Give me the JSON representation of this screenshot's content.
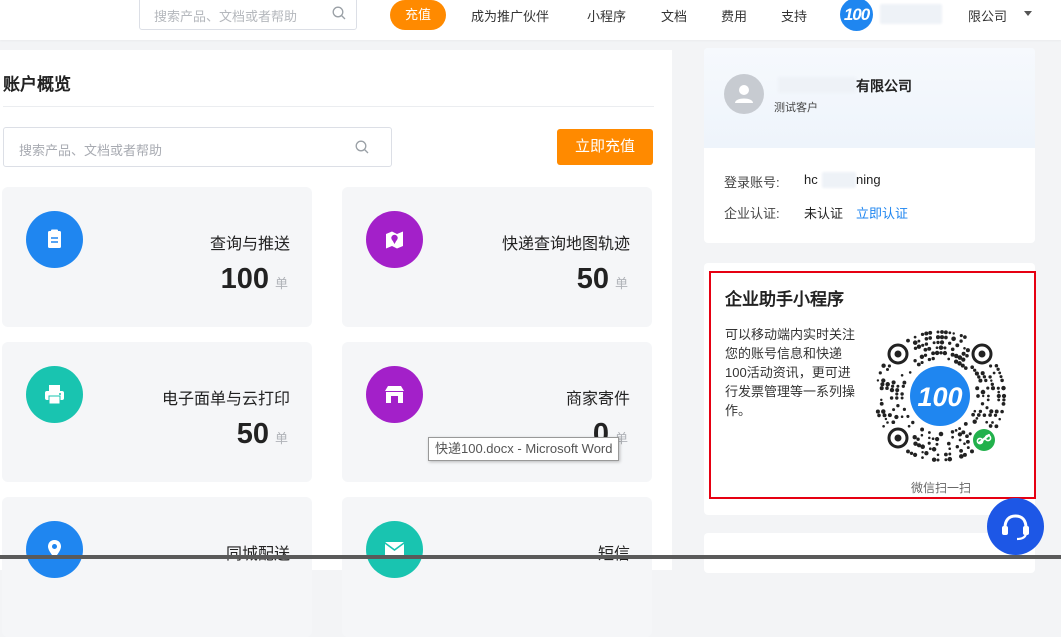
{
  "top": {
    "search_placeholder": "搜索产品、文档或者帮助",
    "recharge": "充值",
    "nav": [
      "成为推广伙伴",
      "小程序",
      "文档",
      "费用",
      "支持"
    ],
    "logo_text": "100",
    "company": "限公司"
  },
  "main": {
    "title": "账户概览",
    "search_placeholder": "搜索产品、文档或者帮助",
    "recharge_button": "立即充值",
    "unit": "单",
    "cards": [
      {
        "title": "查询与推送",
        "count": "100",
        "color": "#1f86f0",
        "icon": "document-icon"
      },
      {
        "title": "快递查询地图轨迹",
        "count": "50",
        "color": "#a320c9",
        "icon": "map-pin-icon"
      },
      {
        "title": "电子面单与云打印",
        "count": "50",
        "color": "#19c4b0",
        "icon": "printer-icon"
      },
      {
        "title": "商家寄件",
        "count": "0",
        "color": "#a320c9",
        "icon": "store-icon"
      },
      {
        "title": "同城配送",
        "count": "",
        "color": "#1f86f0",
        "icon": "location-icon"
      },
      {
        "title": "短信",
        "count": "",
        "color": "#19c4b0",
        "icon": "sms-icon"
      }
    ]
  },
  "account": {
    "company_name": "有限公司",
    "role": "测试客户",
    "login_label": "登录账号:",
    "login_value": "hc",
    "login_value_tail": "ning",
    "cert_label": "企业认证:",
    "cert_value": "未认证",
    "cert_link": "立即认证"
  },
  "miniprogram": {
    "title": "企业助手小程序",
    "description": "可以移动端内实时关注您的账号信息和快递100活动资讯，更可进行发票管理等一系列操作。",
    "qr_logo": "100",
    "caption": "微信扫一扫"
  },
  "tooltip": "快递100.docx - Microsoft Word",
  "colors": {
    "orange": "#ff8a00",
    "blue": "#1f86f0",
    "highlight_border": "#e60012",
    "fab": "#1d57e6"
  }
}
